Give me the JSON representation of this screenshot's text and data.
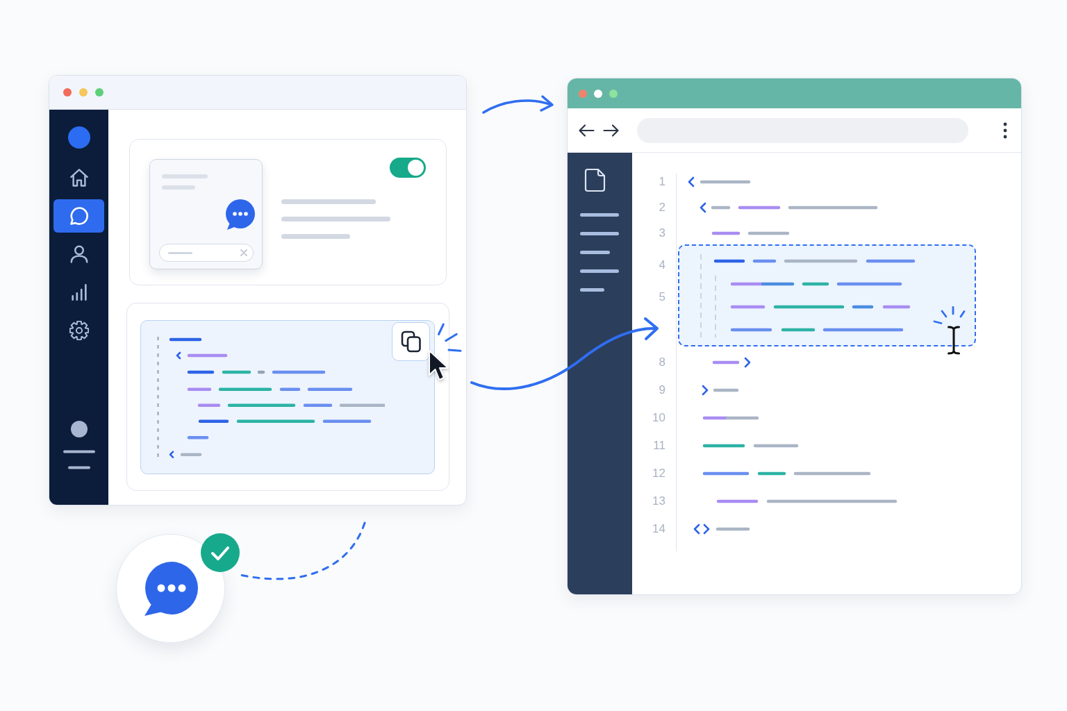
{
  "left_window": {
    "sidebar": {
      "items": [
        {
          "kind": "home",
          "selected": false
        },
        {
          "kind": "chat",
          "selected": true
        },
        {
          "kind": "user",
          "selected": false
        },
        {
          "kind": "chart",
          "selected": false
        },
        {
          "kind": "settings",
          "selected": false
        }
      ]
    },
    "preview_card": {
      "toggle": {
        "on": true
      }
    }
  },
  "editor_window": {
    "line_numbers": [
      "1",
      "2",
      "3",
      "4",
      "5",
      "8",
      "9",
      "10",
      "11",
      "12",
      "13",
      "14"
    ]
  }
}
